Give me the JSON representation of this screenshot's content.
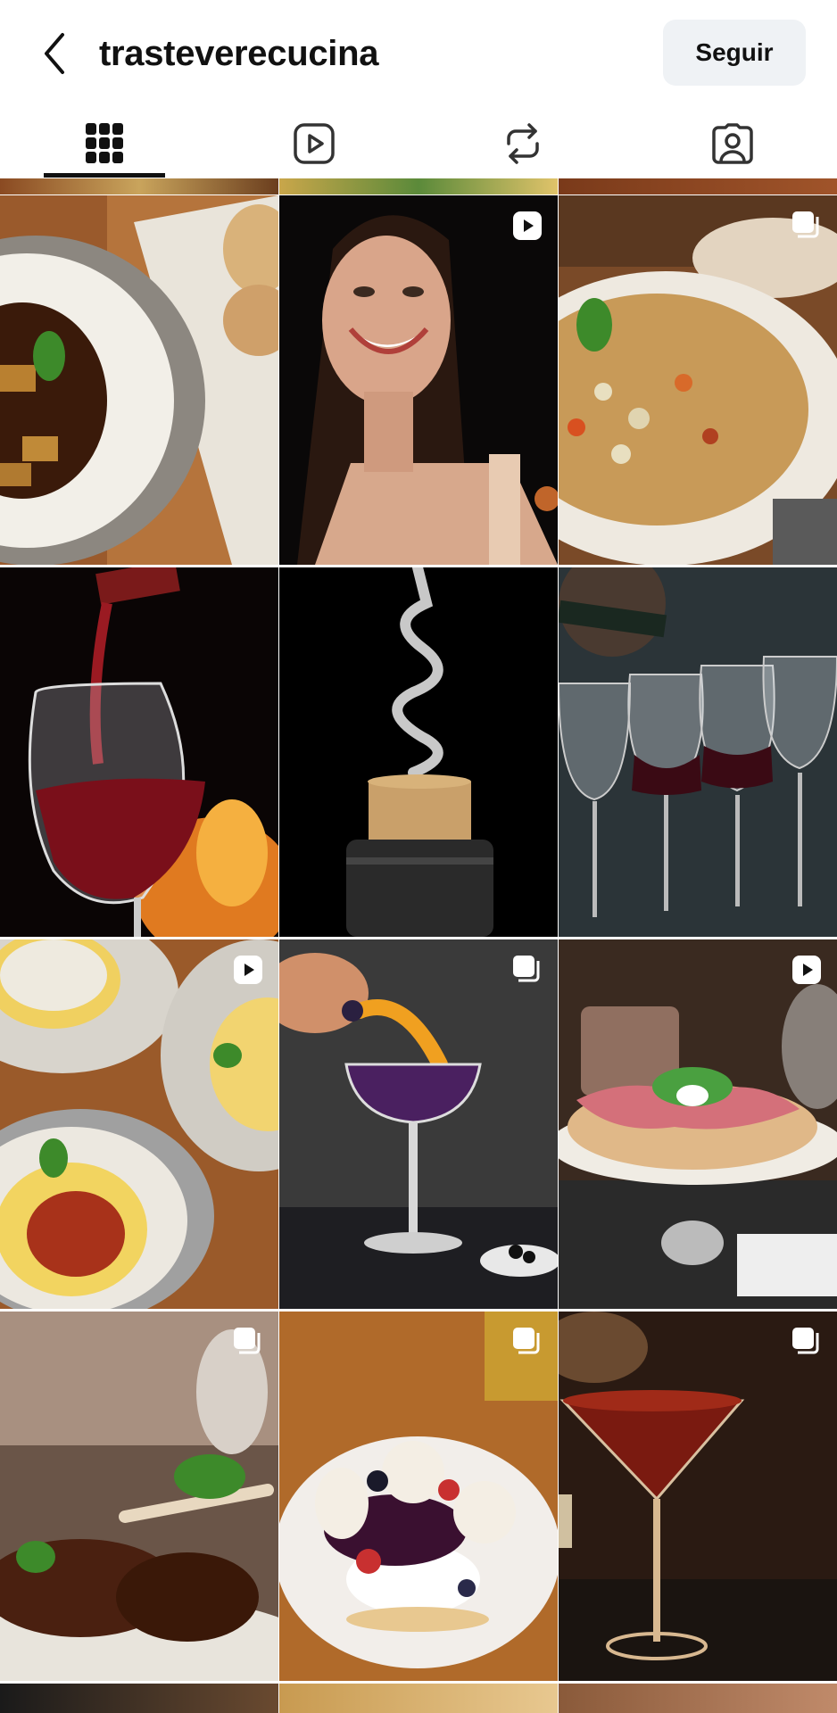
{
  "header": {
    "username": "trasteverecucina",
    "follow_label": "Seguir"
  },
  "tabs": [
    {
      "name": "grid",
      "icon": "grid-icon",
      "active": true
    },
    {
      "name": "reels",
      "icon": "reels-icon",
      "active": false
    },
    {
      "name": "reposts",
      "icon": "repost-icon",
      "active": false
    },
    {
      "name": "tagged",
      "icon": "tagged-user-icon",
      "active": false
    }
  ],
  "posts": [
    {
      "type": "photo",
      "badge": "none",
      "subject": "tortellini-broth"
    },
    {
      "type": "video",
      "badge": "reel-icon",
      "subject": "smiling-woman"
    },
    {
      "type": "carousel",
      "badge": "carousel-icon",
      "subject": "minestrone-soup"
    },
    {
      "type": "photo",
      "badge": "none",
      "subject": "red-wine-pour"
    },
    {
      "type": "photo",
      "badge": "none",
      "subject": "corkscrew"
    },
    {
      "type": "photo",
      "badge": "none",
      "subject": "wine-glasses"
    },
    {
      "type": "video",
      "badge": "reel-icon",
      "subject": "polenta-plates"
    },
    {
      "type": "carousel",
      "badge": "carousel-icon",
      "subject": "cocktail-garnish"
    },
    {
      "type": "video",
      "badge": "reel-icon",
      "subject": "prosciutto-pizza"
    },
    {
      "type": "carousel",
      "badge": "carousel-icon",
      "subject": "lamb-chops"
    },
    {
      "type": "carousel",
      "badge": "carousel-icon",
      "subject": "dessert-plate"
    },
    {
      "type": "carousel",
      "badge": "carousel-icon",
      "subject": "martini-cocktail"
    }
  ],
  "colors": {
    "text": "#111111",
    "button_bg": "#eff2f5",
    "badge": "#ffffff"
  }
}
